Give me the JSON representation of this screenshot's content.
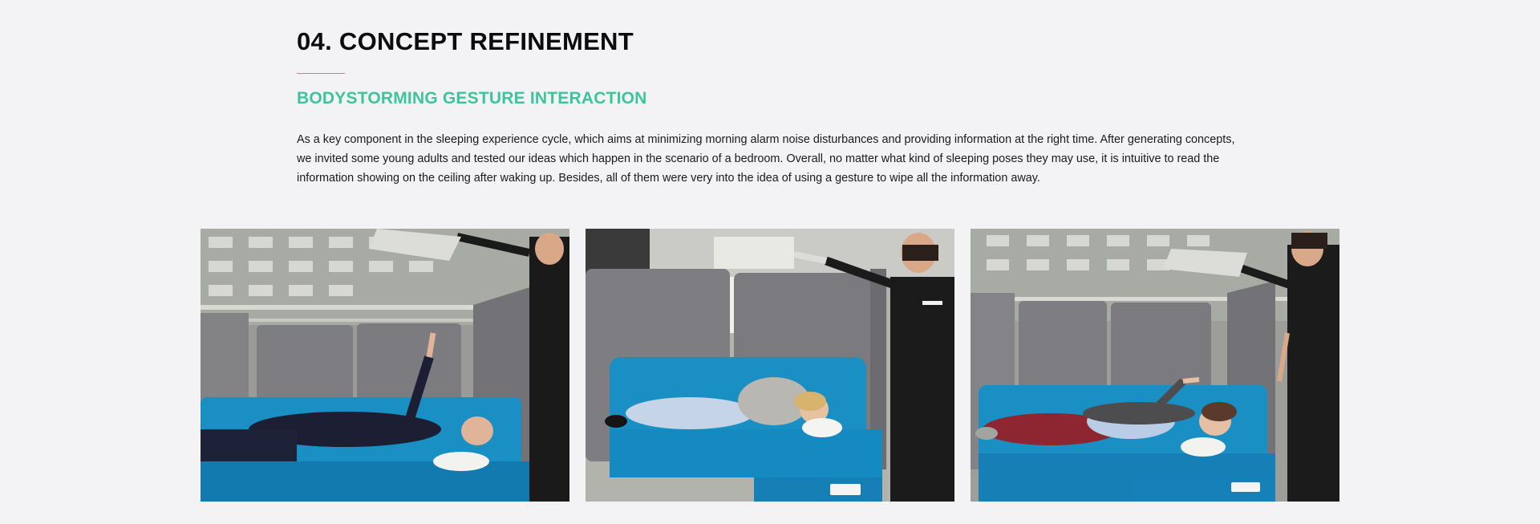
{
  "section": {
    "title": "04. CONCEPT REFINEMENT",
    "subtitle": "BODYSTORMING GESTURE INTERACTION",
    "body": " As a key component in the sleeping experience cycle,  which aims at minimizing morning alarm noise disturbances and providing information at the right time.  After generating concepts, we invited some young adults and tested our ideas which happen in the scenario of a bedroom. Overall, no matter what kind of sleeping poses they may use, it is intuitive to read the information showing on the ceiling after waking up. Besides, all of them were very into the idea of using a gesture to wipe all the information away."
  },
  "colors": {
    "accent": "#3ec49a",
    "background": "#f3f3f5",
    "sofa_blue": "#1a8fc4",
    "booth_gray": "#7b7b80"
  },
  "photos": [
    {
      "icon": "photo-man-lying-pointing-up"
    },
    {
      "icon": "photo-woman-lying-on-side"
    },
    {
      "icon": "photo-person-lying-gesturing"
    }
  ]
}
